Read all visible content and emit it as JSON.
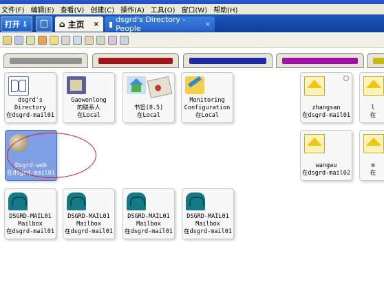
{
  "menubar": [
    "文件(F)",
    "编辑(E)",
    "查看(V)",
    "创建(C)",
    "操作(A)",
    "工具(O)",
    "窗口(W)",
    "帮助(H)"
  ],
  "tabstrip": {
    "open_label": "打开",
    "tabs": [
      {
        "label": "主页",
        "close": "×"
      },
      {
        "label": "dsgrd's Directory - People",
        "close": "×"
      }
    ]
  },
  "toolbar_icon_count": 11,
  "category_colors": [
    "#8f8f8f",
    "#a1141a",
    "#1a2aa7",
    "#a10fa9",
    "#c9b60f"
  ],
  "workspace": {
    "cards": [
      {
        "label": "dsgrd's\nDirectory\n在dsgrd-mail01",
        "icon": "address-book-icon"
      },
      {
        "label": "Gaowenlong\n的联系人\n在Local",
        "icon": "notebook-icon"
      },
      {
        "label": "书签(8.5)\n在Local",
        "icon": "bookmark-house-icon"
      },
      {
        "label": "Monitoring\nConfiguration\n在Local",
        "icon": "pencil-config-icon"
      },
      {
        "label": "Dsgrd-web\n在dsgrd-mail01",
        "icon": "globe-icon",
        "selected": true
      },
      {
        "label": "DSGRD-MAIL01\nMailbox\n在dsgrd-mail01",
        "icon": "mailbox-icon"
      },
      {
        "label": "DSGRD-MAIL01\nMailbox\n在dsgrd-mail01",
        "icon": "mailbox-icon"
      },
      {
        "label": "DSGRD-MAIL01\nMailbox\n在dsgrd-mail01",
        "icon": "mailbox-icon"
      },
      {
        "label": "DSGRD-MAIL01\nMailbox\n在dsgrd-mail01",
        "icon": "mailbox-icon"
      },
      {
        "label": "zhangsan\n在dsgrd-mail01",
        "icon": "envelope-icon"
      },
      {
        "label": "l\n在",
        "icon": "envelope-icon"
      },
      {
        "label": "wangwu\n在dsgrd-mail02",
        "icon": "envelope-icon"
      },
      {
        "label": "m\n在",
        "icon": "envelope-icon"
      }
    ]
  }
}
